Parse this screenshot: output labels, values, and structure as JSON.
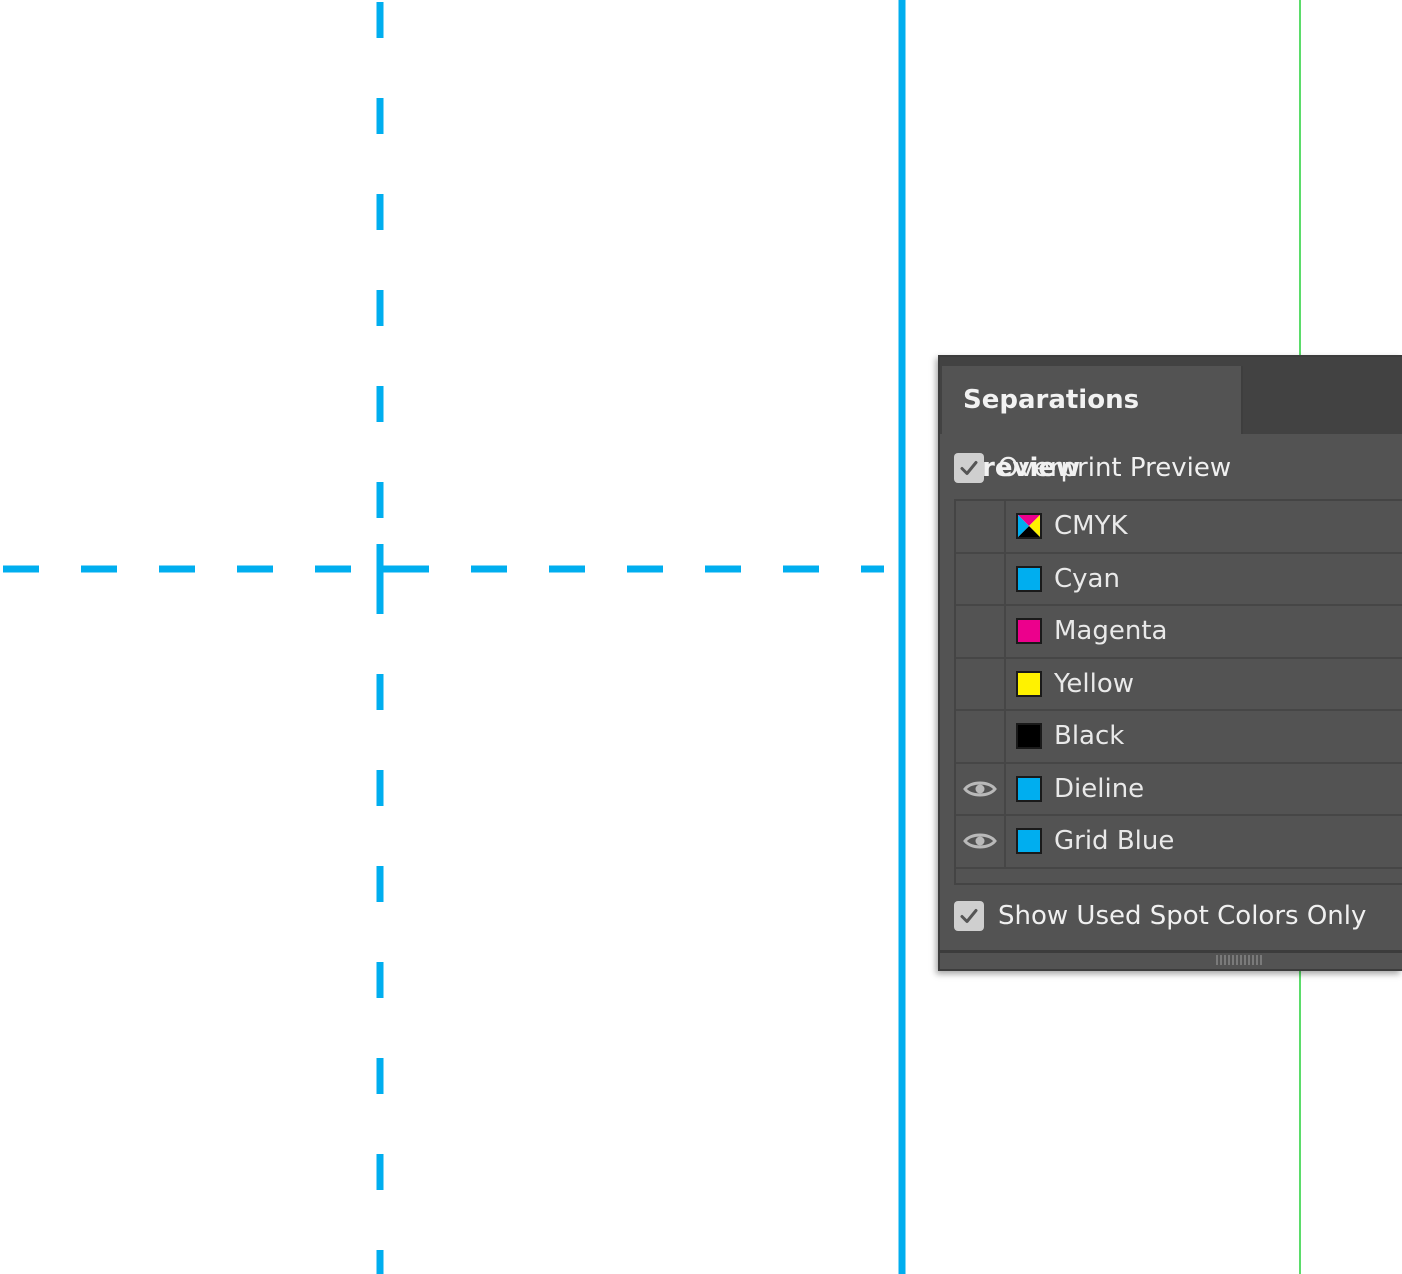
{
  "colors": {
    "dieline_blue": "#00aeef",
    "guide_green": "#5bdc6a",
    "panel_bg": "#535353"
  },
  "panel": {
    "title": "Separations Preview",
    "overprint": {
      "label": "Overprint Preview",
      "checked": true
    },
    "separations": [
      {
        "label": "CMYK",
        "swatch": "cmyk",
        "visible_eye": false
      },
      {
        "label": "Cyan",
        "swatch": "#00aeef",
        "visible_eye": false
      },
      {
        "label": "Magenta",
        "swatch": "#ec008c",
        "visible_eye": false
      },
      {
        "label": "Yellow",
        "swatch": "#fff200",
        "visible_eye": false
      },
      {
        "label": "Black",
        "swatch": "#000000",
        "visible_eye": false
      },
      {
        "label": "Dieline",
        "swatch": "#00aeef",
        "visible_eye": true,
        "icon": "eye-icon"
      },
      {
        "label": "Grid Blue",
        "swatch": "#00aeef",
        "visible_eye": true,
        "icon": "eye-icon"
      }
    ],
    "spot_only": {
      "label": "Show Used Spot Colors Only",
      "checked": true
    }
  }
}
